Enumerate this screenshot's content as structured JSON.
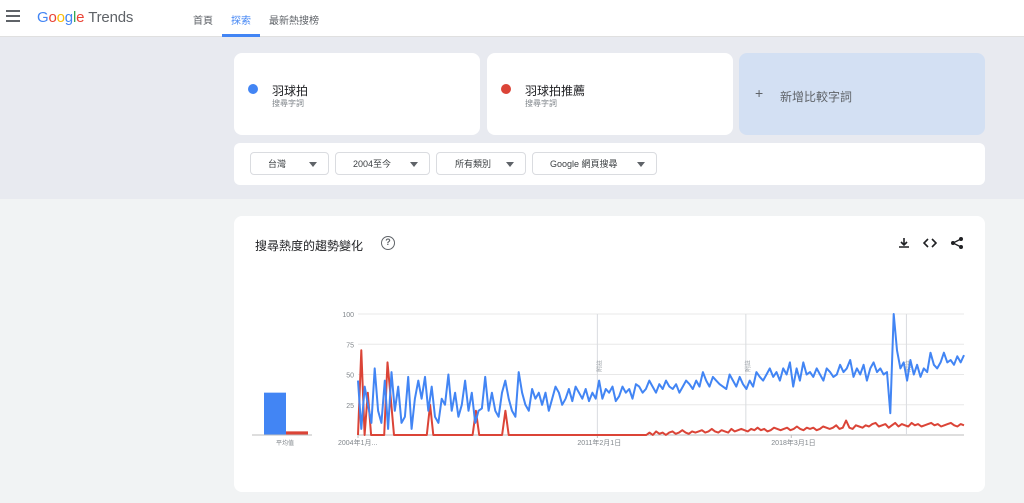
{
  "header": {
    "logo_google": "Google",
    "logo_trends": "Trends",
    "nav": [
      {
        "label": "首頁"
      },
      {
        "label": "探索"
      },
      {
        "label": "最新熱搜榜"
      }
    ],
    "active_nav": 1
  },
  "terms": [
    {
      "name": "羽球拍",
      "sub": "搜尋字詞",
      "color": "#4285f4"
    },
    {
      "name": "羽球拍推薦",
      "sub": "搜尋字詞",
      "color": "#db4437"
    }
  ],
  "add_term": {
    "plus": "+",
    "label": "新增比較字詞"
  },
  "filters": [
    {
      "label": "台灣"
    },
    {
      "label": "2004至今"
    },
    {
      "label": "所有類別"
    },
    {
      "label": "Google 網頁搜尋"
    }
  ],
  "card": {
    "title": "搜尋熱度的趨勢變化",
    "help": "?",
    "icons": [
      "download-icon",
      "embed-icon",
      "share-icon"
    ]
  },
  "chart_data": {
    "type": "line",
    "title": "搜尋熱度的趨勢變化",
    "ylim": [
      0,
      100
    ],
    "y_ticks": [
      25,
      50,
      75,
      100
    ],
    "x_tick_labels": [
      "2004年1月...",
      "2011年2月1日",
      "2018年3月1日"
    ],
    "annotations": [
      {
        "label": "附註"
      },
      {
        "label": "附註"
      },
      {
        "label": "附註"
      }
    ],
    "average": {
      "label": "平均值",
      "values": [
        35,
        3
      ]
    },
    "series": [
      {
        "name": "羽球拍",
        "color": "#4285f4",
        "values": [
          45,
          5,
          40,
          25,
          10,
          55,
          20,
          10,
          45,
          5,
          52,
          20,
          40,
          10,
          15,
          48,
          5,
          30,
          45,
          30,
          48,
          20,
          40,
          15,
          10,
          30,
          25,
          50,
          20,
          35,
          15,
          25,
          45,
          20,
          35,
          10,
          20,
          22,
          48,
          20,
          35,
          20,
          15,
          35,
          45,
          30,
          20,
          15,
          52,
          35,
          25,
          20,
          38,
          30,
          35,
          25,
          35,
          20,
          30,
          40,
          35,
          25,
          30,
          38,
          28,
          40,
          35,
          30,
          38,
          28,
          35,
          30,
          45,
          30,
          38,
          35,
          40,
          28,
          32,
          40,
          35,
          38,
          30,
          42,
          40,
          35,
          38,
          45,
          40,
          35,
          42,
          38,
          45,
          40,
          38,
          42,
          35,
          40,
          45,
          42,
          38,
          45,
          40,
          52,
          45,
          40,
          48,
          45,
          42,
          40,
          38,
          50,
          45,
          40,
          48,
          42,
          38,
          45,
          40,
          52,
          48,
          45,
          50,
          55,
          48,
          52,
          45,
          55,
          50,
          60,
          40,
          55,
          45,
          60,
          50,
          52,
          48,
          55,
          50,
          45,
          55,
          52,
          48,
          50,
          58,
          52,
          55,
          62,
          48,
          55,
          50,
          58,
          45,
          55,
          60,
          52,
          55,
          50,
          52,
          18,
          100,
          70,
          55,
          60,
          45,
          62,
          50,
          58,
          48,
          55,
          52,
          68,
          58,
          55,
          60,
          68,
          60,
          62,
          58,
          65,
          60,
          66
        ]
      },
      {
        "name": "羽球拍推薦",
        "color": "#db4437",
        "values": [
          0,
          70,
          0,
          35,
          0,
          0,
          0,
          0,
          0,
          60,
          30,
          0,
          0,
          0,
          0,
          0,
          0,
          0,
          0,
          0,
          0,
          0,
          25,
          0,
          0,
          0,
          0,
          0,
          0,
          0,
          0,
          0,
          0,
          0,
          0,
          0,
          20,
          0,
          0,
          0,
          0,
          0,
          0,
          0,
          0,
          20,
          0,
          0,
          0,
          0,
          0,
          0,
          0,
          0,
          0,
          0,
          0,
          0,
          0,
          0,
          0,
          0,
          0,
          0,
          0,
          0,
          0,
          0,
          0,
          0,
          0,
          0,
          0,
          0,
          0,
          0,
          0,
          0,
          0,
          0,
          0,
          0,
          0,
          0,
          0,
          0,
          0,
          0,
          0,
          2,
          0,
          3,
          1,
          2,
          0,
          2,
          3,
          1,
          2,
          4,
          2,
          1,
          3,
          2,
          3,
          4,
          2,
          3,
          5,
          3,
          2,
          4,
          3,
          2,
          5,
          3,
          4,
          5,
          4,
          3,
          5,
          4,
          6,
          4,
          5,
          3,
          4,
          6,
          5,
          4,
          5,
          6,
          4,
          5,
          7,
          5,
          4,
          6,
          5,
          6,
          4,
          5,
          7,
          6,
          5,
          6,
          8,
          5,
          6,
          12,
          6,
          5,
          8,
          7,
          6,
          8,
          7,
          9,
          10,
          7,
          8,
          9,
          6,
          8,
          10,
          7,
          9,
          8,
          7,
          10,
          8,
          9,
          7,
          8,
          9,
          10,
          8,
          9,
          7,
          8,
          9,
          10,
          8,
          7,
          9,
          8
        ]
      }
    ]
  }
}
